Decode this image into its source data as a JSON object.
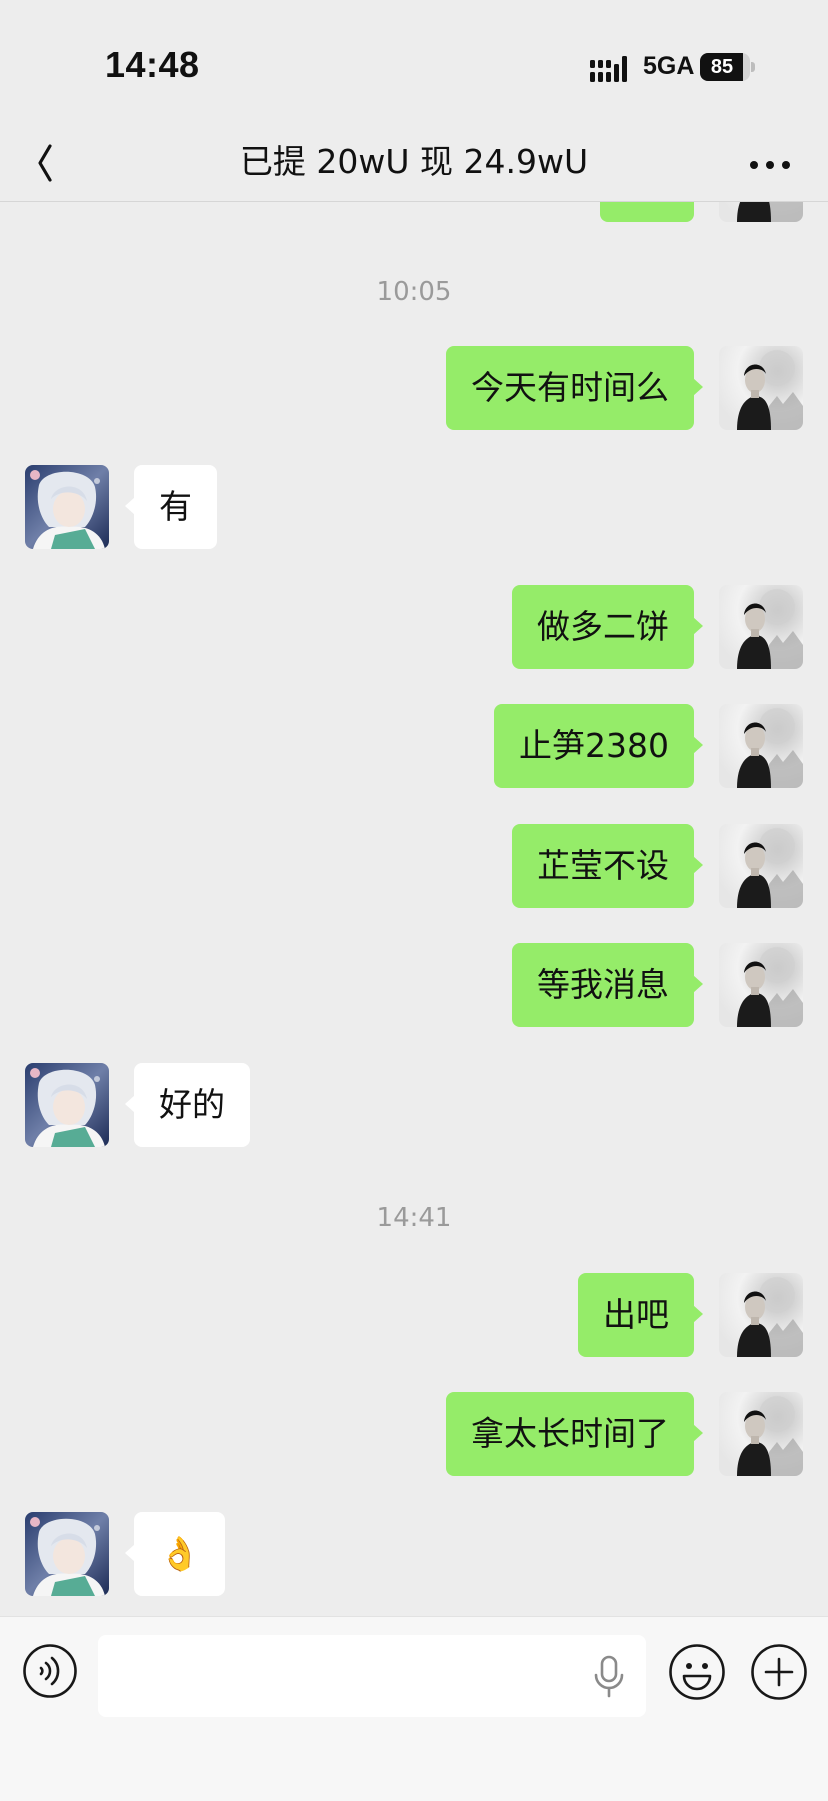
{
  "status_bar": {
    "time": "14:48",
    "network": "5GA",
    "battery_percent": 85
  },
  "nav": {
    "title": "已提 20wU 现 24.9wU",
    "back_icon": "chevron-left-icon",
    "more_icon": "ellipsis-icon"
  },
  "colors": {
    "background": "#ededed",
    "outgoing_bubble": "#95ec69",
    "incoming_bubble": "#ffffff",
    "timestamp": "#9a9a9a"
  },
  "messages": {
    "t1": "10:05",
    "m1": "今天有时间么",
    "m2": "有",
    "m3": "做多二饼",
    "m4": "止笋2380",
    "m5": "芷莹不设",
    "m6": "等我消息",
    "m7": "好的",
    "t2": "14:41",
    "m8": "出吧",
    "m9": "拿太长时间了",
    "m10": "👌"
  },
  "input_bar": {
    "voice_icon": "voice-mode-icon",
    "message_value": "",
    "mic_icon": "microphone-icon",
    "emoji_icon": "emoji-icon",
    "add_icon": "plus-icon"
  }
}
